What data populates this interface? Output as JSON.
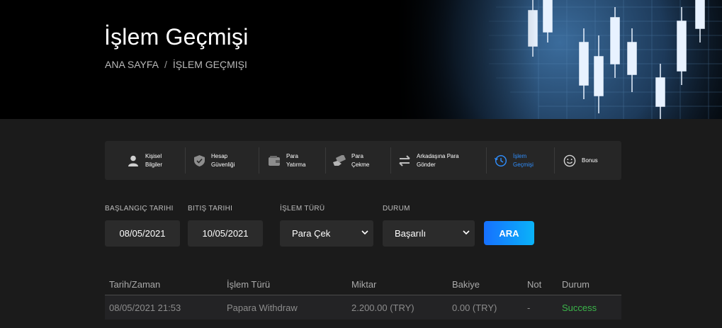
{
  "header": {
    "title": "İşlem Geçmişi",
    "breadcrumb": {
      "home": "ANA SAYFA",
      "separator": "/",
      "current": "İŞLEM GEÇMIŞI"
    }
  },
  "tabs": [
    {
      "label": "Kişisel\nBilgiler",
      "icon": "user-icon"
    },
    {
      "label": "Hesap\nGüvenliği",
      "icon": "shield-check-icon"
    },
    {
      "label": "Para\nYatırma",
      "icon": "wallet-icon"
    },
    {
      "label": "Para\nÇekme",
      "icon": "cash-hand-icon"
    },
    {
      "label": "Arkadaşına Para\nGönder",
      "icon": "transfer-arrows-icon"
    },
    {
      "label": "İşlem\nGeçmişi",
      "icon": "history-icon",
      "active": true
    },
    {
      "label": "Bonus",
      "icon": "smile-icon"
    }
  ],
  "filters": {
    "start_date": {
      "label": "BAŞLANGIÇ TARIHI",
      "value": "08/05/2021"
    },
    "end_date": {
      "label": "BITIŞ TARIHI",
      "value": "10/05/2021"
    },
    "type": {
      "label": "İŞLEM TÜRÜ",
      "value": "Para Çek"
    },
    "status": {
      "label": "DURUM",
      "value": "Başarılı"
    },
    "search_label": "ARA"
  },
  "table": {
    "columns": [
      "Tarih/Zaman",
      "İşlem Türü",
      "Miktar",
      "Bakiye",
      "Not",
      "Durum"
    ],
    "rows": [
      [
        "08/05/2021 21:53",
        "Papara Withdraw",
        "2.200.00 (TRY)",
        "0.00 (TRY)",
        "-",
        "Success"
      ]
    ]
  },
  "colors": {
    "accent": "#2f8fff",
    "button_start": "#1670ff",
    "button_end": "#0ab3f8",
    "success": "#3bb54a"
  }
}
